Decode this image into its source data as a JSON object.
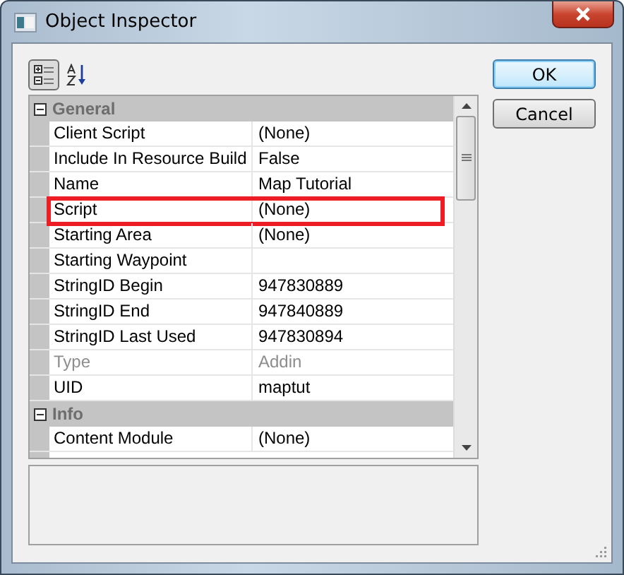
{
  "window": {
    "title": "Object Inspector"
  },
  "toolbar": [
    {
      "kind": "categorized",
      "selected": true
    },
    {
      "kind": "alphabetical",
      "selected": false
    }
  ],
  "grid": {
    "rows": [
      {
        "kind": "category",
        "label": "General",
        "expanded": true
      },
      {
        "kind": "property",
        "name": "Client Script",
        "value": "(None)",
        "disabled": false,
        "highlighted": false
      },
      {
        "kind": "property",
        "name": "Include In Resource Build",
        "value": "False",
        "disabled": false,
        "highlighted": false
      },
      {
        "kind": "property",
        "name": "Name",
        "value": "Map Tutorial",
        "disabled": false,
        "highlighted": false
      },
      {
        "kind": "property",
        "name": "Script",
        "value": "(None)",
        "disabled": false,
        "highlighted": true
      },
      {
        "kind": "property",
        "name": "Starting Area",
        "value": "(None)",
        "disabled": false,
        "highlighted": false
      },
      {
        "kind": "property",
        "name": "Starting Waypoint",
        "disabled": false,
        "highlighted": false
      },
      {
        "kind": "property",
        "name": "StringID Begin",
        "value": "947830889",
        "disabled": false,
        "highlighted": false
      },
      {
        "kind": "property",
        "name": "StringID End",
        "value": "947840889",
        "disabled": false,
        "highlighted": false
      },
      {
        "kind": "property",
        "name": "StringID Last Used",
        "value": "947830894",
        "disabled": false,
        "highlighted": false
      },
      {
        "kind": "property",
        "name": "Type",
        "value": "Addin",
        "disabled": true,
        "highlighted": false
      },
      {
        "kind": "property",
        "name": "UID",
        "value": "maptut",
        "disabled": false,
        "highlighted": false
      },
      {
        "kind": "category",
        "label": "Info",
        "expanded": true
      },
      {
        "kind": "property",
        "name": "Content Module",
        "value": "(None)",
        "disabled": false,
        "highlighted": false
      }
    ]
  },
  "buttons": [
    {
      "label": "OK",
      "default": true
    },
    {
      "label": "Cancel",
      "default": false
    }
  ]
}
